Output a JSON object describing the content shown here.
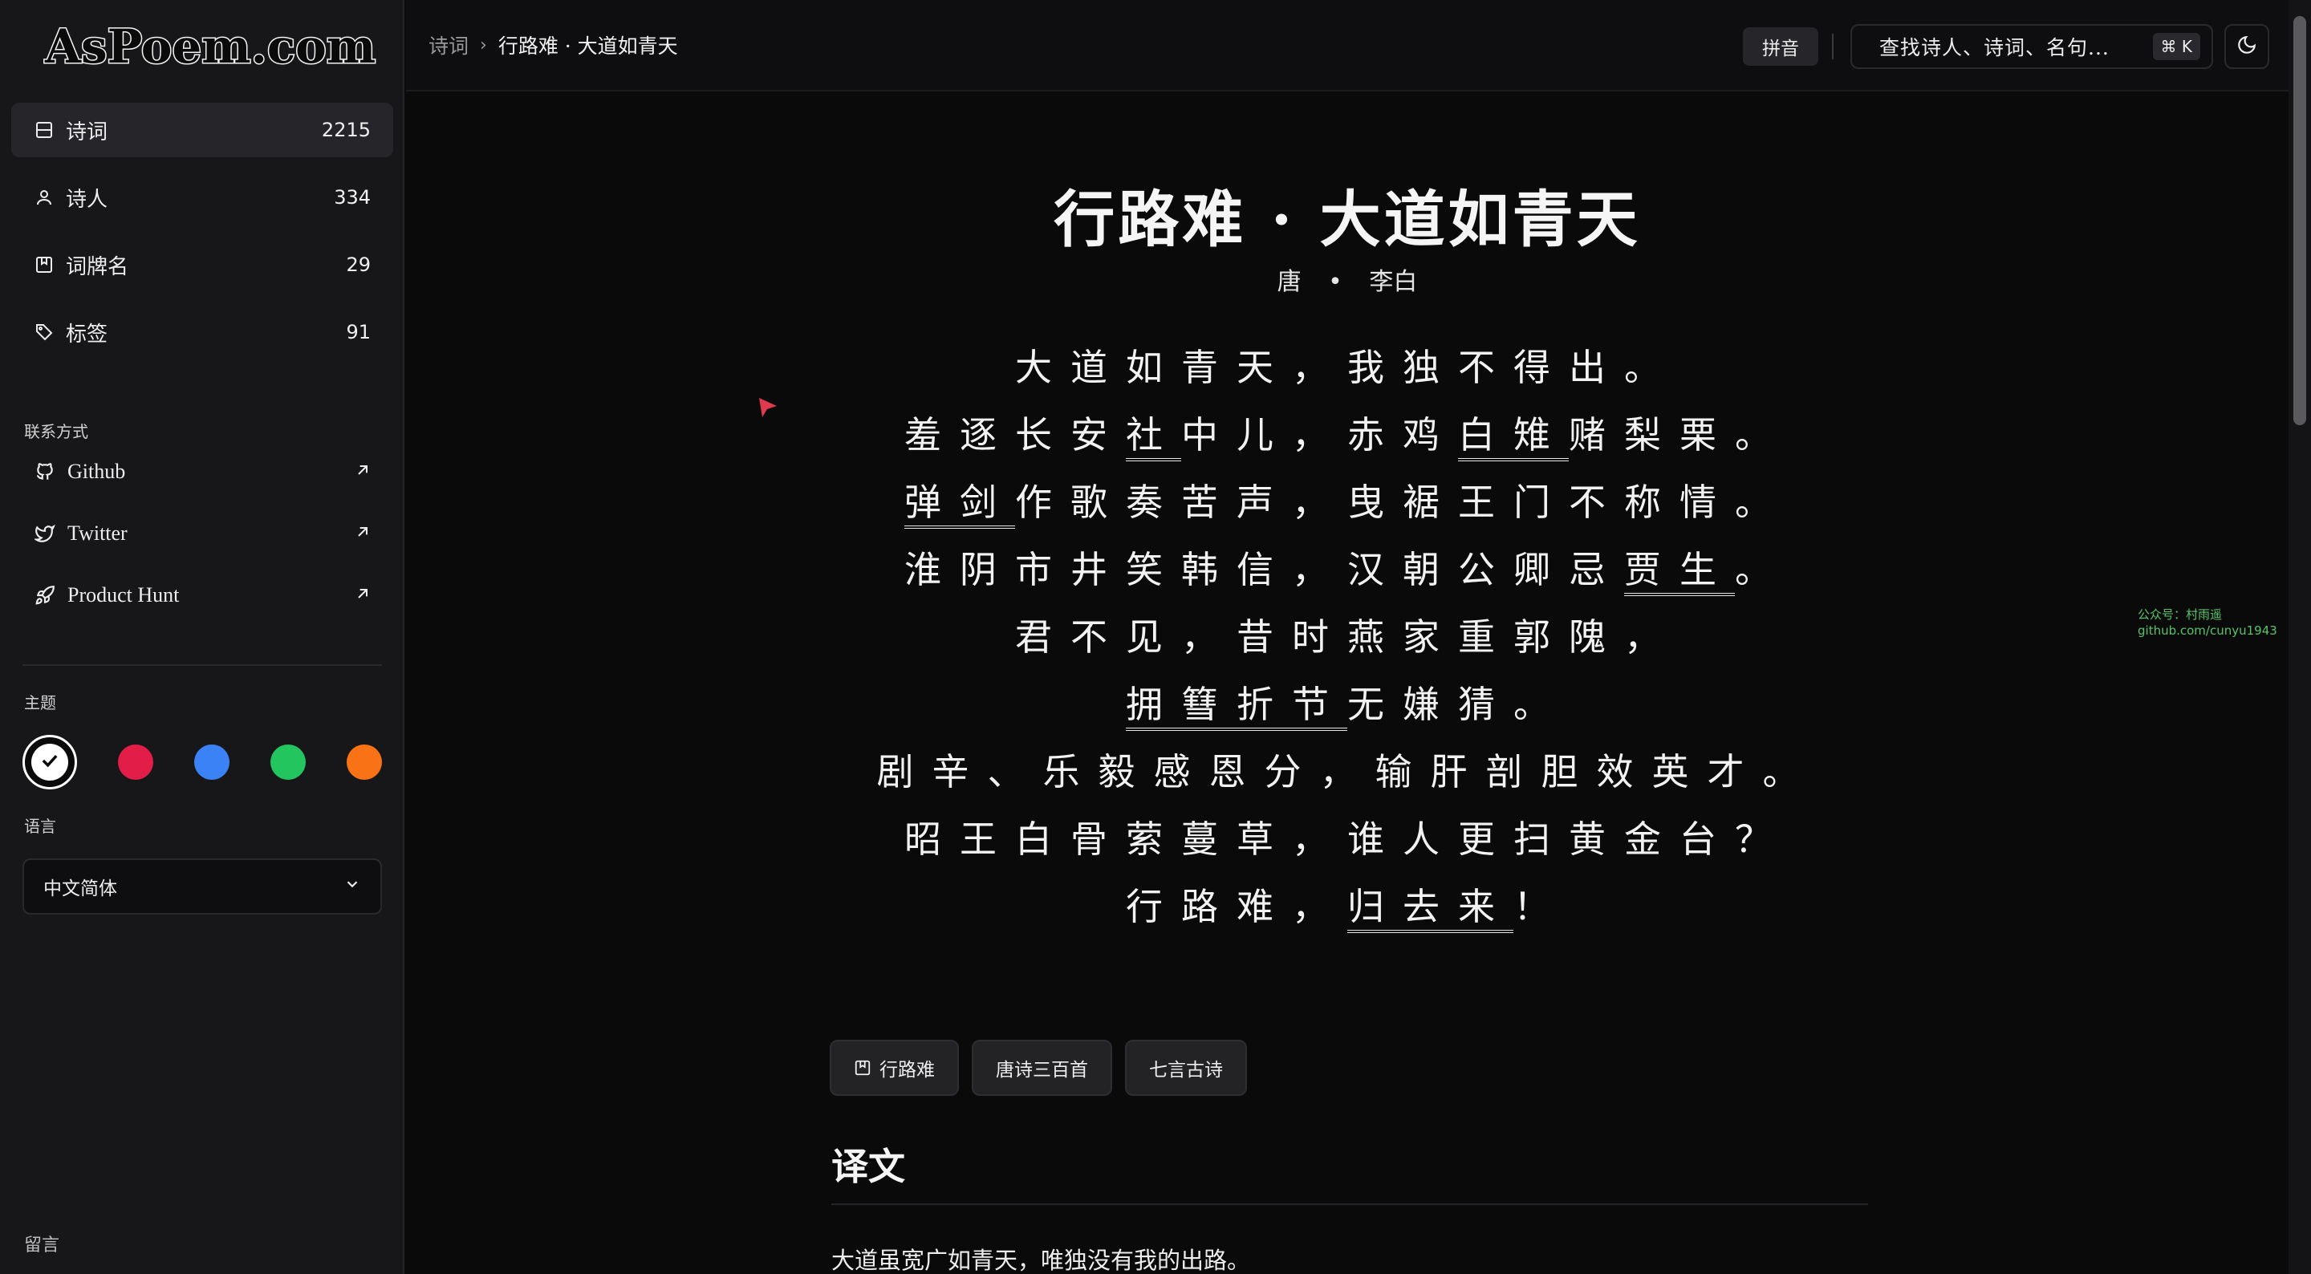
{
  "sidebar": {
    "logo": "AsPoem.com",
    "nav": [
      {
        "label": "诗词",
        "count": "2215"
      },
      {
        "label": "诗人",
        "count": "334"
      },
      {
        "label": "词牌名",
        "count": "29"
      },
      {
        "label": "标签",
        "count": "91"
      }
    ],
    "contact_title": "联系方式",
    "links": [
      {
        "label": "Github"
      },
      {
        "label": "Twitter"
      },
      {
        "label": "Product Hunt"
      }
    ],
    "theme_title": "主题",
    "theme_colors": [
      "#ffffff",
      "#e11d48",
      "#3b82f6",
      "#22c55e",
      "#f97316"
    ],
    "language_title": "语言",
    "language_value": "中文简体",
    "footer": "留言"
  },
  "header": {
    "breadcrumb_root": "诗词",
    "breadcrumb_current": "行路难 · 大道如青天",
    "pinyin_label": "拼音",
    "search_placeholder": "查找诗人、诗词、名句...",
    "shortcut": "⌘ K"
  },
  "poem": {
    "title": "行路难 · 大道如青天",
    "dynasty": "唐",
    "separator": "•",
    "author": "李白",
    "lines": [
      [
        {
          "t": "大道如青天，我独不得出。"
        }
      ],
      [
        {
          "t": "羞逐长安"
        },
        {
          "t": "社",
          "note": true
        },
        {
          "t": "中儿，赤鸡"
        },
        {
          "t": "白雉",
          "note": true
        },
        {
          "t": "赌梨栗。"
        }
      ],
      [
        {
          "t": "弹剑",
          "note": true
        },
        {
          "t": "作歌奏苦声，曳裾王门不称情。"
        }
      ],
      [
        {
          "t": "淮阴市井笑韩信，汉朝公卿忌"
        },
        {
          "t": "贾生",
          "note": true
        },
        {
          "t": "。"
        }
      ],
      [
        {
          "t": "君不见，昔时燕家重郭隗，"
        }
      ],
      [
        {
          "t": "拥篲",
          "note": true
        },
        {
          "t": "折节",
          "note": true
        },
        {
          "t": "无嫌猜。"
        }
      ],
      [
        {
          "t": "剧辛、乐毅感恩分，输肝剖胆效英才。"
        }
      ],
      [
        {
          "t": "昭王白骨萦蔓草，谁人更扫黄金台？"
        }
      ],
      [
        {
          "t": "行路难，"
        },
        {
          "t": "归去来",
          "note": true
        },
        {
          "t": "！"
        }
      ]
    ],
    "tags": [
      "行路难",
      "唐诗三百首",
      "七言古诗"
    ],
    "translation_heading": "译文",
    "translation_first_line": "大道虽宽广如青天，唯独没有我的出路。"
  },
  "watermark": {
    "line1": "公众号：村雨遥",
    "line2": "github.com/cunyu1943"
  }
}
